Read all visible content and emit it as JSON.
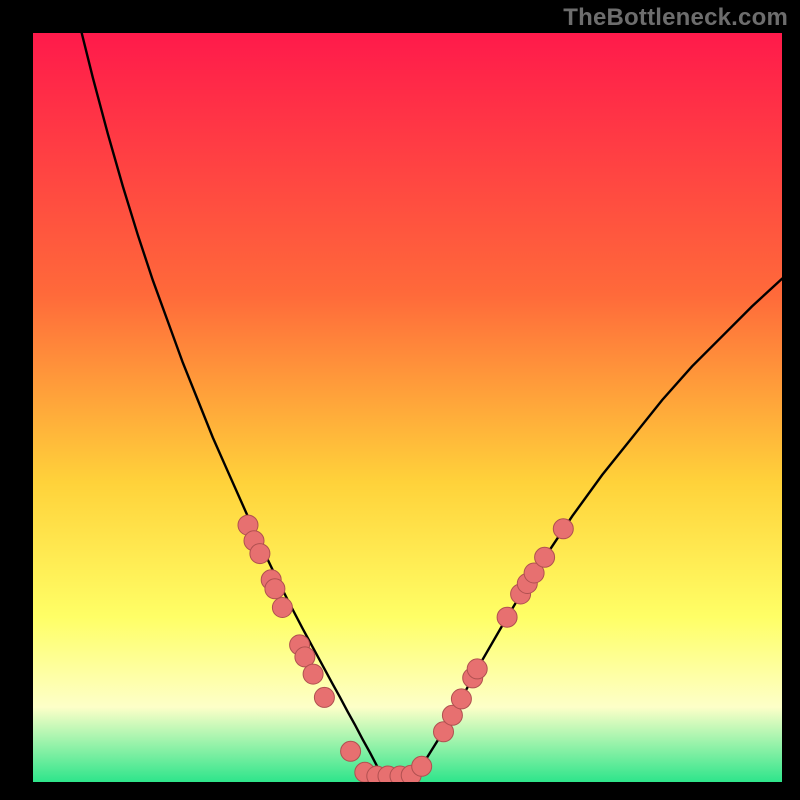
{
  "attribution": "TheBottleneck.com",
  "colors": {
    "frame": "#000000",
    "gradient_top": "#ff1a4b",
    "gradient_mid1": "#ff6a3a",
    "gradient_mid2": "#ffd23a",
    "gradient_mid3": "#ffff66",
    "gradient_mid4": "#fdffc8",
    "gradient_bottom": "#2ee58b",
    "curve": "#000000",
    "dot_fill": "#e77070",
    "dot_stroke": "#b05050"
  },
  "chart_data": {
    "type": "line",
    "title": "",
    "xlabel": "",
    "ylabel": "",
    "xlim": [
      0,
      100
    ],
    "ylim": [
      0,
      100
    ],
    "series": [
      {
        "name": "curve",
        "x": [
          6.5,
          8,
          10,
          12,
          14,
          16,
          18,
          20,
          22,
          24,
          26,
          28,
          30,
          32,
          34,
          36,
          38,
          40,
          41,
          42,
          43,
          44,
          45,
          46,
          47,
          48,
          49,
          50,
          52,
          54,
          56,
          58,
          60,
          63,
          66,
          69,
          72,
          76,
          80,
          84,
          88,
          92,
          96,
          100
        ],
        "values": [
          100,
          94,
          86.5,
          79.5,
          73,
          67,
          61.5,
          56,
          51,
          46,
          41.5,
          37,
          32.5,
          28.3,
          24.3,
          20.5,
          16.8,
          13.1,
          11.3,
          9.4,
          7.6,
          5.7,
          3.9,
          2,
          1,
          1,
          1,
          1,
          2.3,
          5.5,
          9,
          12.6,
          16.3,
          21.5,
          26.5,
          31,
          35.5,
          41,
          46,
          51,
          55.5,
          59.5,
          63.5,
          67.2
        ]
      }
    ],
    "dots": [
      {
        "x": 28.7,
        "y": 34.3
      },
      {
        "x": 29.5,
        "y": 32.2
      },
      {
        "x": 30.3,
        "y": 30.5
      },
      {
        "x": 31.8,
        "y": 27.0
      },
      {
        "x": 32.3,
        "y": 25.8
      },
      {
        "x": 33.3,
        "y": 23.3
      },
      {
        "x": 35.6,
        "y": 18.3
      },
      {
        "x": 36.3,
        "y": 16.7
      },
      {
        "x": 37.4,
        "y": 14.4
      },
      {
        "x": 38.9,
        "y": 11.3
      },
      {
        "x": 42.4,
        "y": 4.1
      },
      {
        "x": 44.3,
        "y": 1.3
      },
      {
        "x": 45.9,
        "y": 0.8
      },
      {
        "x": 47.4,
        "y": 0.8
      },
      {
        "x": 49.0,
        "y": 0.8
      },
      {
        "x": 50.5,
        "y": 0.9
      },
      {
        "x": 51.9,
        "y": 2.1
      },
      {
        "x": 54.8,
        "y": 6.7
      },
      {
        "x": 56.0,
        "y": 8.9
      },
      {
        "x": 57.2,
        "y": 11.1
      },
      {
        "x": 58.7,
        "y": 13.9
      },
      {
        "x": 59.3,
        "y": 15.1
      },
      {
        "x": 63.3,
        "y": 22.0
      },
      {
        "x": 65.1,
        "y": 25.1
      },
      {
        "x": 66.0,
        "y": 26.5
      },
      {
        "x": 66.9,
        "y": 27.9
      },
      {
        "x": 68.3,
        "y": 30.0
      },
      {
        "x": 70.8,
        "y": 33.8
      }
    ]
  }
}
